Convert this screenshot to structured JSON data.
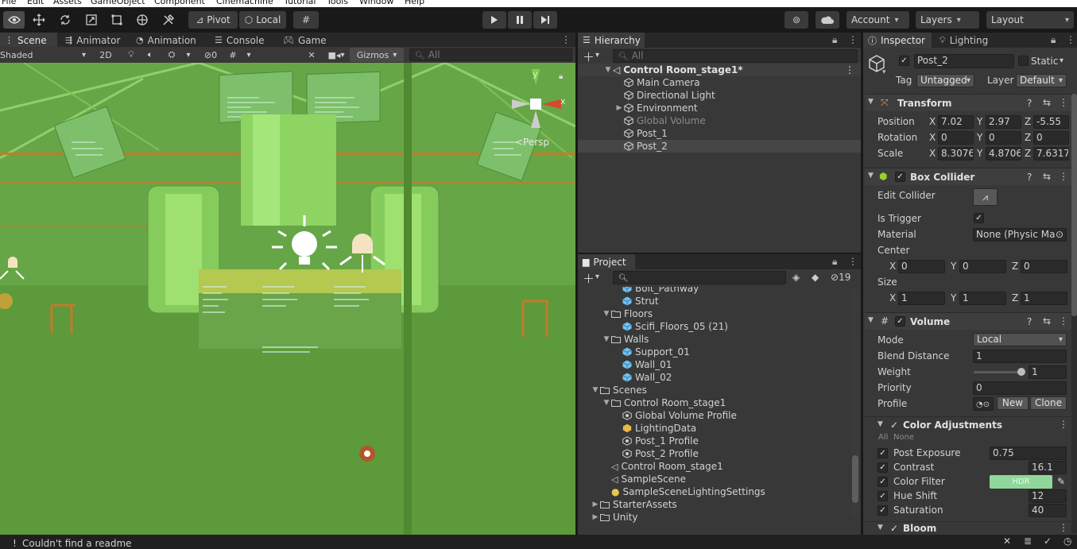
{
  "menubar": [
    "File",
    "Edit",
    "Assets",
    "GameObject",
    "Component",
    "Cinemachine",
    "Tutorial",
    "Tools",
    "Window",
    "Help"
  ],
  "toolbar": {
    "pivot_label": "Pivot",
    "local_label": "Local",
    "account_label": "Account",
    "layers_label": "Layers",
    "layout_label": "Layout"
  },
  "scene_tabs": [
    "Scene",
    "Animator",
    "Animation",
    "Console",
    "Game"
  ],
  "scene_toolbar": {
    "shading": "Shaded",
    "mode_2d": "2D",
    "hidden_count": "0",
    "gizmos": "Gizmos",
    "search_placeholder": "All",
    "persp": "<Persp",
    "axis_x": "x",
    "axis_y": "y"
  },
  "hierarchy": {
    "tab": "Hierarchy",
    "search_placeholder": "All",
    "scene_name": "Control Room_stage1*",
    "items": [
      {
        "label": "Main Camera",
        "dim": false
      },
      {
        "label": "Directional Light",
        "dim": false
      },
      {
        "label": "Environment",
        "dim": false
      },
      {
        "label": "Global Volume",
        "dim": true
      },
      {
        "label": "Post_1",
        "dim": false
      },
      {
        "label": "Post_2",
        "dim": false
      }
    ]
  },
  "project": {
    "tab": "Project",
    "hidden_count": "19",
    "rows": [
      {
        "label": "Bolt_Pathway",
        "depth": 2,
        "kind": "prefab"
      },
      {
        "label": "Strut",
        "depth": 2,
        "kind": "prefab"
      },
      {
        "label": "Floors",
        "depth": 1,
        "kind": "folder-open"
      },
      {
        "label": "Scifi_Floors_05 (21)",
        "depth": 2,
        "kind": "prefab"
      },
      {
        "label": "Walls",
        "depth": 1,
        "kind": "folder-open"
      },
      {
        "label": "Support_01",
        "depth": 2,
        "kind": "prefab"
      },
      {
        "label": "Wall_01",
        "depth": 2,
        "kind": "prefab"
      },
      {
        "label": "Wall_02",
        "depth": 2,
        "kind": "prefab"
      },
      {
        "label": "Scenes",
        "depth": 0,
        "kind": "folder-open"
      },
      {
        "label": "Control Room_stage1",
        "depth": 1,
        "kind": "folder-open"
      },
      {
        "label": "Global Volume Profile",
        "depth": 2,
        "kind": "profile"
      },
      {
        "label": "LightingData",
        "depth": 2,
        "kind": "lighting"
      },
      {
        "label": "Post_1 Profile",
        "depth": 2,
        "kind": "profile"
      },
      {
        "label": "Post_2 Profile",
        "depth": 2,
        "kind": "profile"
      },
      {
        "label": "Control Room_stage1",
        "depth": 1,
        "kind": "scene"
      },
      {
        "label": "SampleScene",
        "depth": 1,
        "kind": "scene"
      },
      {
        "label": "SampleSceneLightingSettings",
        "depth": 1,
        "kind": "lightsettings"
      },
      {
        "label": "StarterAssets",
        "depth": 0,
        "kind": "folder-closed"
      },
      {
        "label": "Unity",
        "depth": 0,
        "kind": "folder-closed"
      }
    ]
  },
  "inspector": {
    "tab": "Inspector",
    "lighting_tab": "Lighting",
    "object_name": "Post_2",
    "static_label": "Static",
    "tag_label": "Tag",
    "tag_value": "Untagged",
    "layer_label": "Layer",
    "layer_value": "Default",
    "transform": {
      "title": "Transform",
      "position_label": "Position",
      "position": [
        "7.02",
        "2.97",
        "-5.55"
      ],
      "rotation_label": "Rotation",
      "rotation": [
        "0",
        "0",
        "0"
      ],
      "scale_label": "Scale",
      "scale": [
        "8.3076",
        "4.8706",
        "7.6317"
      ]
    },
    "box_collider": {
      "title": "Box Collider",
      "edit_collider": "Edit Collider",
      "is_trigger": "Is Trigger",
      "material_label": "Material",
      "material_value": "None (Physic Ma",
      "center_label": "Center",
      "center": [
        "0",
        "0",
        "0"
      ],
      "size_label": "Size",
      "size": [
        "1",
        "1",
        "1"
      ]
    },
    "volume": {
      "title": "Volume",
      "mode_label": "Mode",
      "mode_value": "Local",
      "blend_label": "Blend Distance",
      "blend_value": "1",
      "weight_label": "Weight",
      "weight_value": "1",
      "weight_fraction": 1.0,
      "priority_label": "Priority",
      "priority_value": "0",
      "profile_label": "Profile",
      "new_btn": "New",
      "clone_btn": "Clone"
    },
    "color_adjustments": {
      "title": "Color Adjustments",
      "all": "All",
      "none": "None",
      "post_exposure_label": "Post Exposure",
      "post_exposure": "0.75",
      "contrast_label": "Contrast",
      "contrast": "16.1",
      "color_filter_label": "Color Filter",
      "color_filter_hdr": "HDR",
      "color_filter_color": "#8fd79a",
      "hue_shift_label": "Hue Shift",
      "hue_shift": "12",
      "saturation_label": "Saturation",
      "saturation": "40"
    },
    "bloom_title": "Bloom"
  },
  "status": "Couldn't find a readme",
  "axis_labels": [
    "X",
    "Y",
    "Z"
  ],
  "colors": {
    "scene_green": "#5e9e3d",
    "prefab_blue": "#6fc3f2",
    "selection": "#464646"
  }
}
